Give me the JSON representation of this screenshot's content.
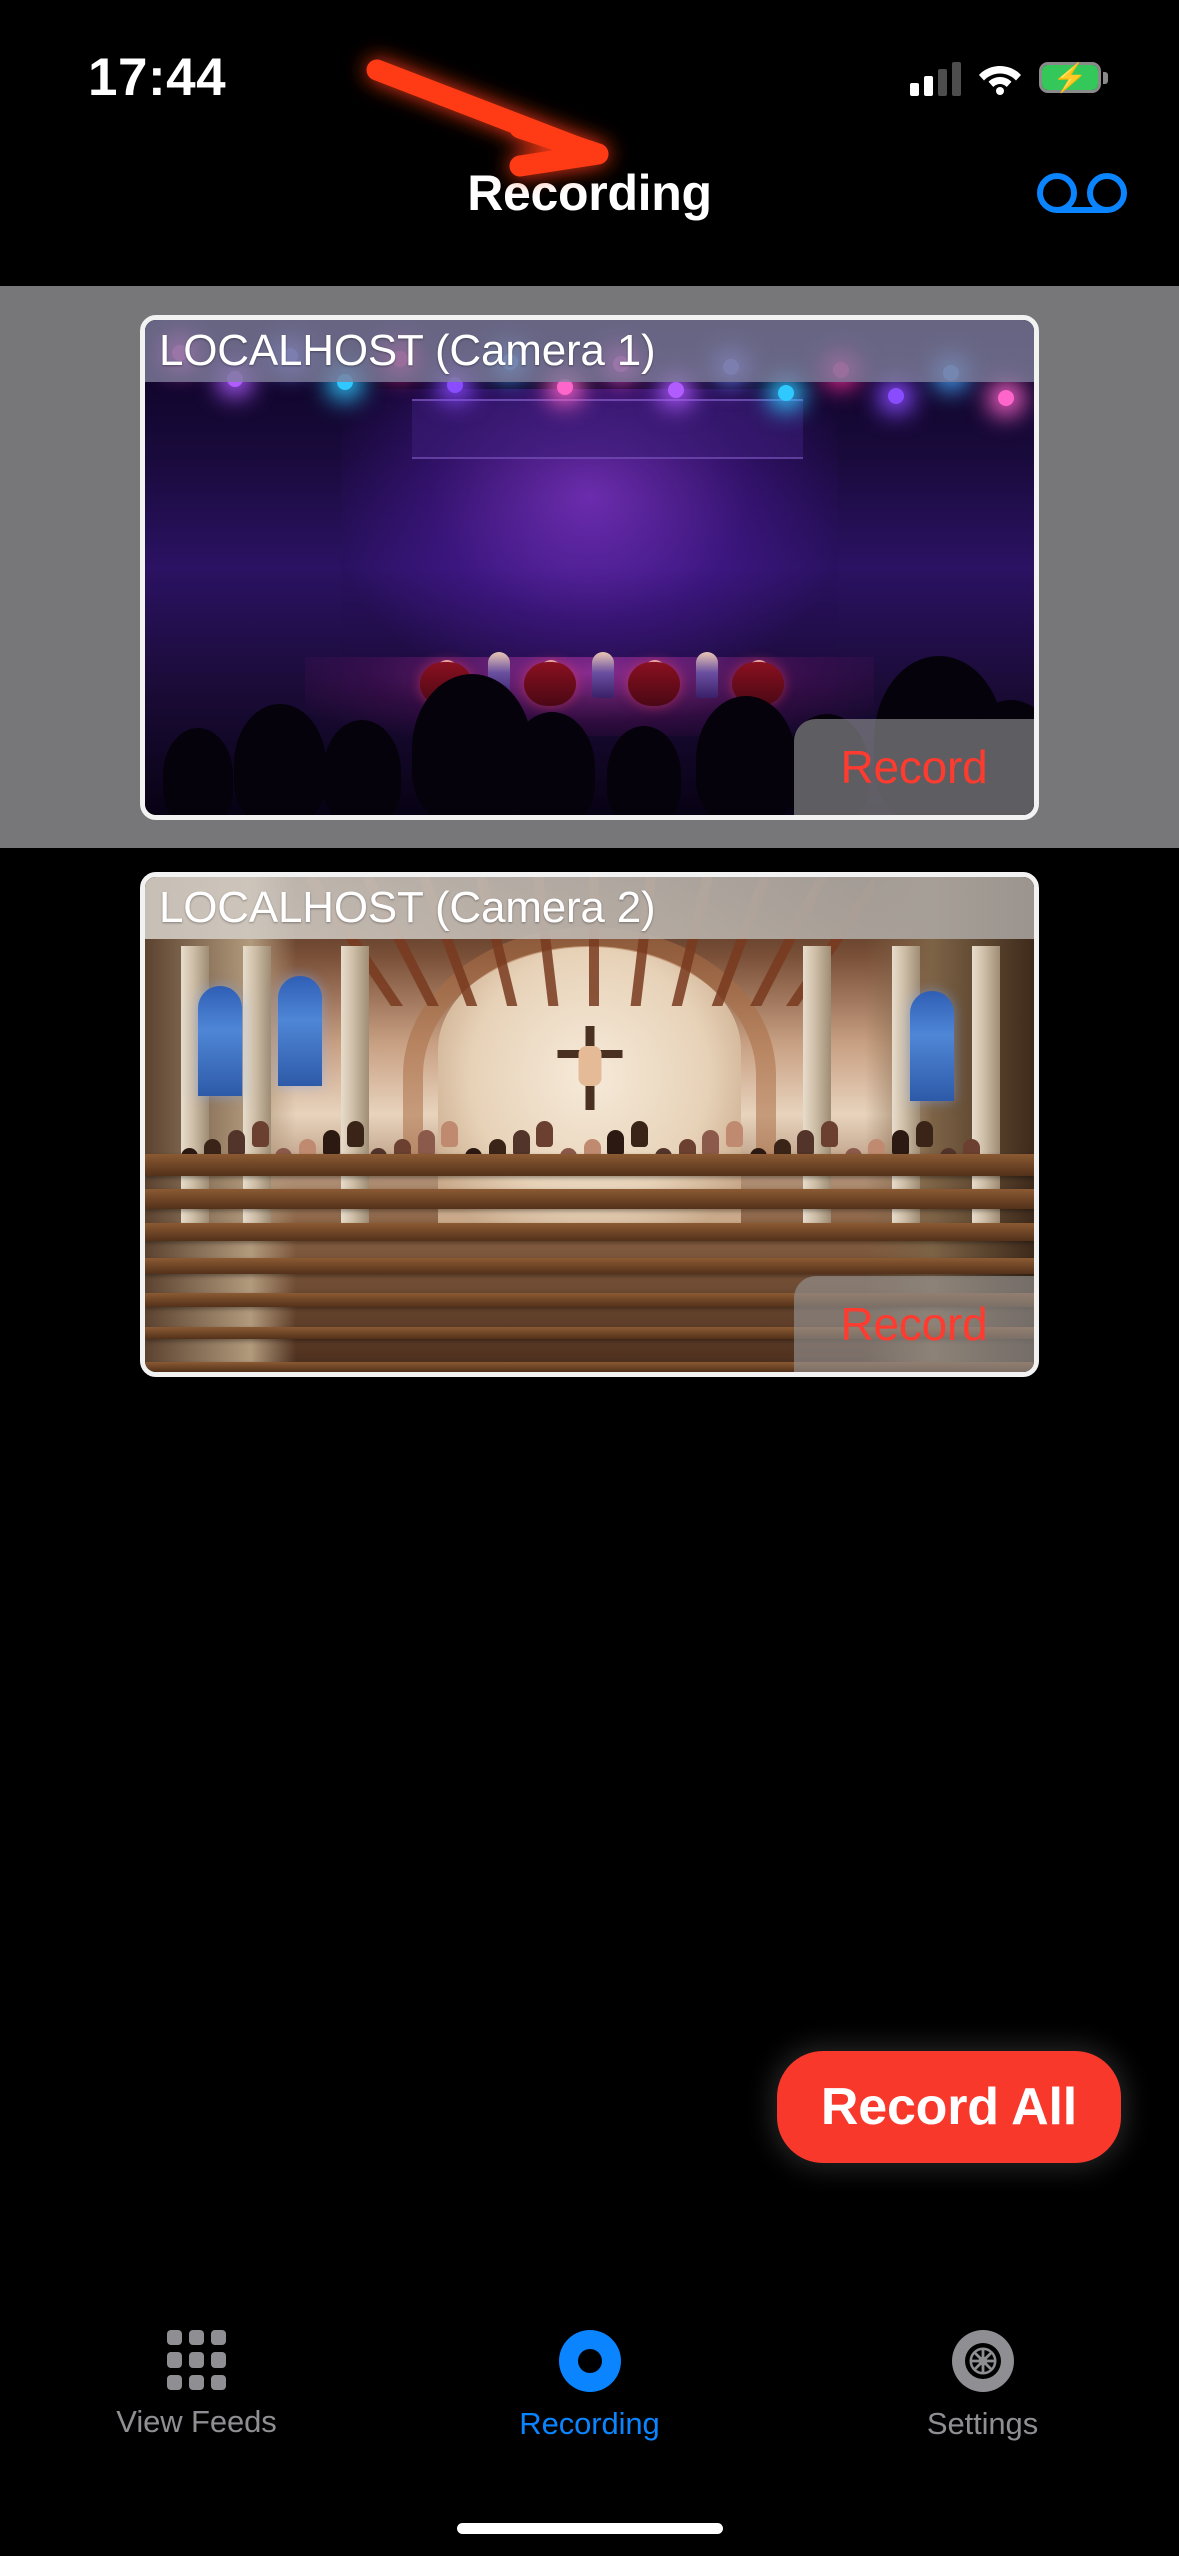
{
  "status_bar": {
    "time": "17:44",
    "signal_icon": "cellular-signal-icon",
    "wifi_icon": "wifi-icon",
    "battery_icon": "battery-charging-icon"
  },
  "nav_bar": {
    "title": "Recording",
    "right_action_icon": "voicemail-icon",
    "right_action_color": "#0a84ff"
  },
  "annotation": {
    "type": "arrow",
    "color": "#ff3b14",
    "points_to": "voicemail-icon"
  },
  "cameras": [
    {
      "name": "LOCALHOST (Camera 1)",
      "record_label": "Record",
      "record_label_color": "#ff3b30",
      "selected": true,
      "feed": "concert-stage-live-feed"
    },
    {
      "name": "LOCALHOST (Camera 2)",
      "record_label": "Record",
      "record_label_color": "#ff3b30",
      "selected": false,
      "feed": "church-interior-live-feed"
    }
  ],
  "record_all_button": {
    "label": "Record All",
    "background": "#f9382c",
    "text_color": "#ffffff"
  },
  "tab_bar": {
    "items": [
      {
        "label": "View Feeds",
        "icon": "grid-icon",
        "active": false
      },
      {
        "label": "Recording",
        "icon": "record-dot-icon",
        "active": true
      },
      {
        "label": "Settings",
        "icon": "gear-icon",
        "active": false
      }
    ],
    "active_color": "#0a84ff",
    "inactive_color": "#8e8e93"
  }
}
